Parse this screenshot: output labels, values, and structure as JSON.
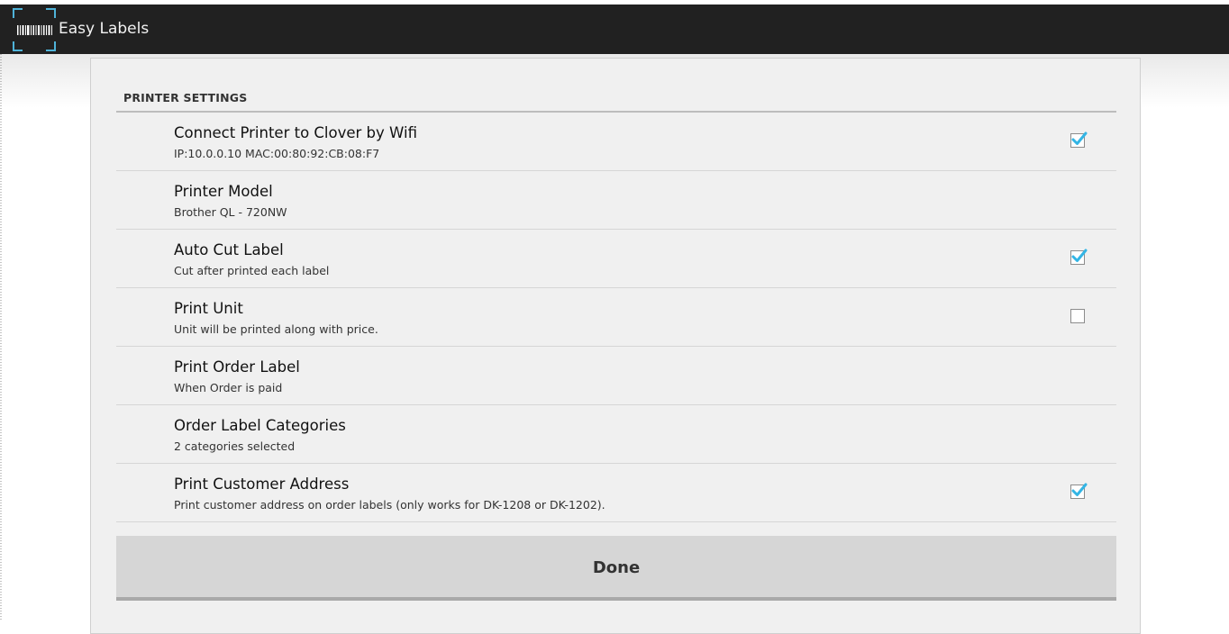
{
  "app": {
    "title": "Easy Labels",
    "icon": "barcode-scan-icon"
  },
  "section": {
    "header": "PRINTER SETTINGS"
  },
  "preferences": [
    {
      "title": "Connect Printer to Clover by Wifi",
      "summary": "IP:10.0.0.10 MAC:00:80:92:CB:08:F7",
      "checked": true
    },
    {
      "title": "Printer Model",
      "summary": "Brother QL - 720NW"
    },
    {
      "title": "Auto Cut Label",
      "summary": "Cut after printed each label",
      "checked": true
    },
    {
      "title": "Print Unit",
      "summary": "Unit will be printed along with price.",
      "checked": false
    },
    {
      "title": "Print Order Label",
      "summary": "When Order is paid"
    },
    {
      "title": "Order Label Categories",
      "summary": "2 categories selected"
    },
    {
      "title": "Print Customer Address",
      "summary": "Print customer address on order labels (only works for DK-1208 or DK-1202).",
      "checked": true
    }
  ],
  "done_button": {
    "label": "Done"
  },
  "colors": {
    "action_bar": "#212121",
    "accent_cyan": "#33b5e5",
    "dialog_bg": "#f0f0f0"
  }
}
